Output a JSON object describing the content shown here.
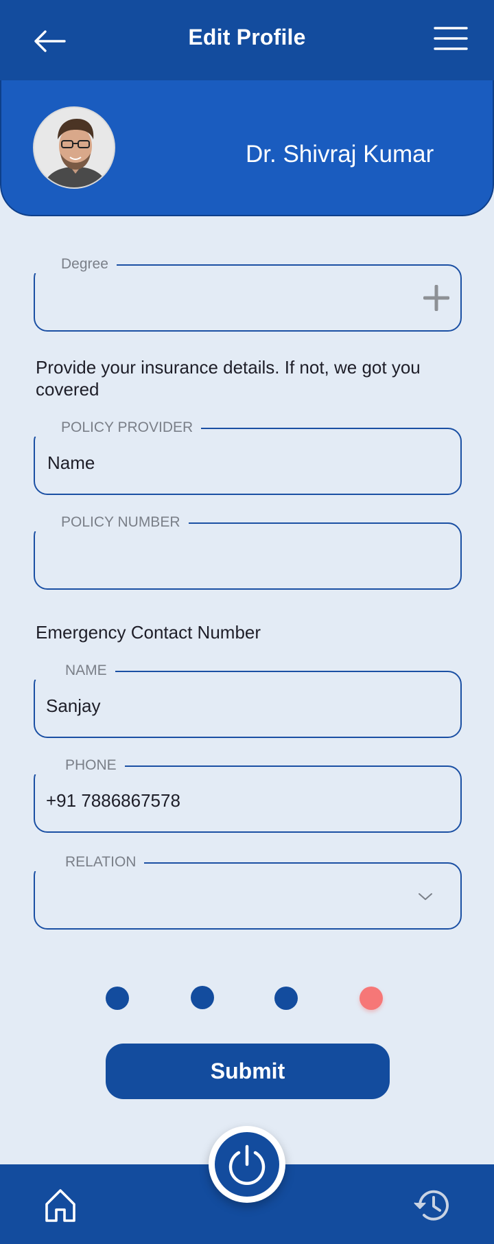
{
  "header": {
    "title": "Edit Profile"
  },
  "profile": {
    "name": "Dr. Shivraj Kumar"
  },
  "degree": {
    "label": "Degree",
    "value": ""
  },
  "insurance": {
    "prompt": "Provide your insurance details. If not, we got you covered",
    "provider": {
      "label": "POLICY PROVIDER",
      "value": "Name"
    },
    "number": {
      "label": "POLICY NUMBER",
      "value": ""
    }
  },
  "emergency": {
    "heading": "Emergency Contact Number",
    "name": {
      "label": "NAME",
      "value": "Sanjay"
    },
    "phone": {
      "label": "PHONE",
      "value": "+91 7886867578"
    },
    "relation": {
      "label": "RELATION",
      "value": ""
    }
  },
  "pagination": {
    "total": 4,
    "active": 4
  },
  "actions": {
    "submit_label": "Submit"
  },
  "colors": {
    "primary": "#134c9e",
    "header_blue": "#1a5cbf",
    "background": "#e3ebf5",
    "active_dot": "#f67777"
  },
  "icons": {
    "back": "back-arrow-icon",
    "menu": "hamburger-menu-icon",
    "add": "plus-icon",
    "dropdown": "chevron-down-icon",
    "power": "power-icon",
    "home": "home-icon",
    "history": "history-icon"
  }
}
